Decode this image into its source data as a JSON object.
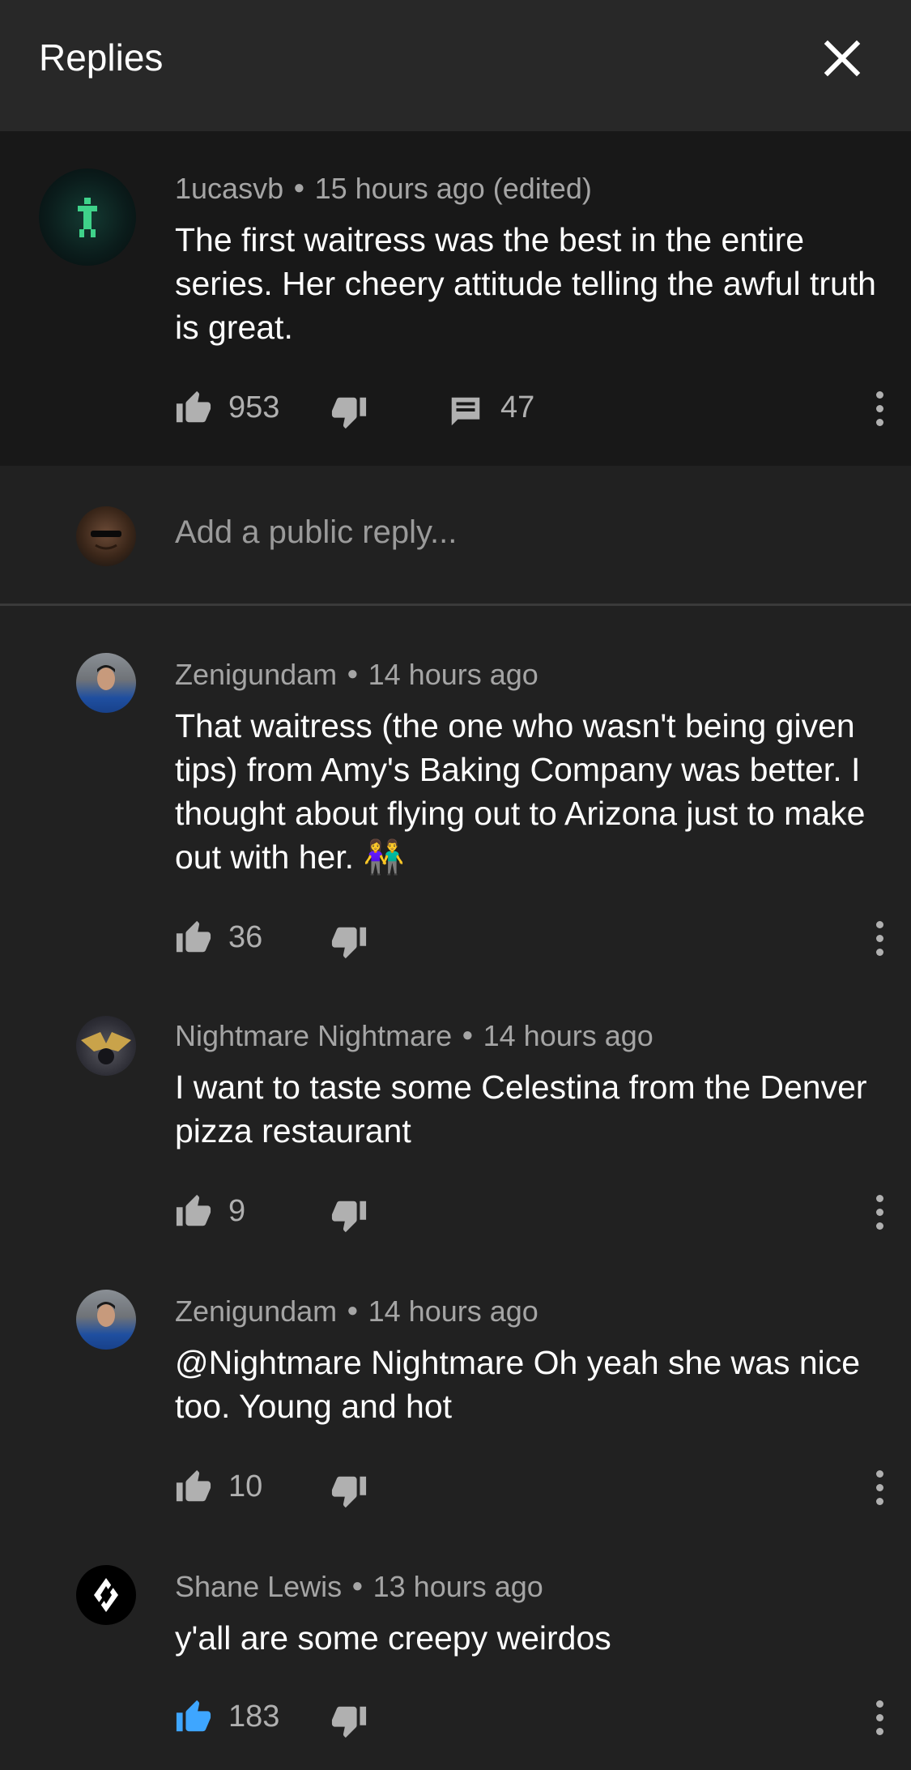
{
  "header": {
    "title": "Replies"
  },
  "parent": {
    "author": "1ucasvb",
    "time": "15 hours ago (edited)",
    "text": "The first waitress was the best in the entire series. Her cheery attitude telling the awful truth is great.",
    "likes": "953",
    "replies": "47"
  },
  "reply_box": {
    "placeholder": "Add a public reply..."
  },
  "replies": [
    {
      "author": "Zenigundam",
      "time": "14 hours ago",
      "text": "That waitress (the one who wasn't being given tips) from Amy's Baking Company was better. I thought about flying out to Arizona just to make out with her. 👫",
      "likes": "36"
    },
    {
      "author": "Nightmare Nightmare",
      "time": "14 hours ago",
      "text": "I want to taste some Celestina from the Denver pizza restaurant",
      "likes": "9"
    },
    {
      "author": "Zenigundam",
      "time": "14 hours ago",
      "text": "@Nightmare Nightmare Oh yeah she was nice too. Young and hot",
      "likes": "10"
    },
    {
      "author": "Shane Lewis",
      "time": "13 hours ago",
      "text": "y'all are some creepy weirdos",
      "likes": "183",
      "liked": true
    }
  ],
  "colors": {
    "background": "#212121",
    "header": "#282828",
    "parent": "#181818",
    "liked": "#3ea6ff"
  }
}
